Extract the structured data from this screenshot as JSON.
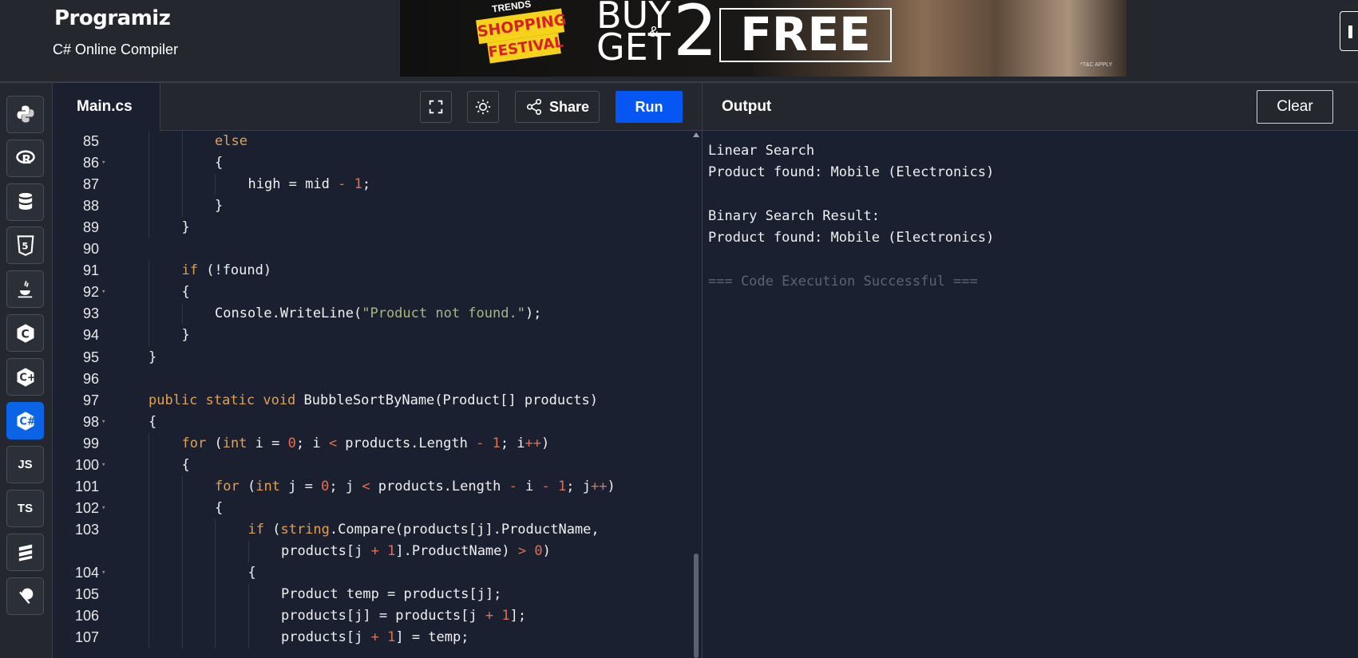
{
  "header": {
    "logo": "Programiz",
    "subtitle": "C# Online Compiler",
    "banner": {
      "trends": "TRENDS",
      "shopping": "SHOPPING",
      "festival": "FESTIVAL",
      "buy": "BUY",
      "amp": "&",
      "get": "GET",
      "two": "2",
      "free": "FREE",
      "tc": "*T&C APPLY"
    }
  },
  "sidebar": {
    "languages": [
      {
        "name": "Python",
        "icon": "python-icon"
      },
      {
        "name": "R",
        "icon": "r-icon"
      },
      {
        "name": "SQL",
        "icon": "database-icon"
      },
      {
        "name": "HTML",
        "icon": "html5-icon"
      },
      {
        "name": "Java",
        "icon": "java-icon"
      },
      {
        "name": "C",
        "icon": "c-icon"
      },
      {
        "name": "C++",
        "icon": "cpp-icon"
      },
      {
        "name": "C#",
        "icon": "csharp-icon",
        "active": true
      },
      {
        "name": "JS",
        "label": "JS",
        "icon": "javascript-icon"
      },
      {
        "name": "TS",
        "label": "TS",
        "icon": "typescript-icon"
      },
      {
        "name": "Swift",
        "icon": "swift-icon"
      },
      {
        "name": "Go",
        "icon": "go-icon"
      }
    ]
  },
  "editor": {
    "file_tab": "Main.cs",
    "share_label": "Share",
    "run_label": "Run"
  },
  "output": {
    "title": "Output",
    "clear_label": "Clear",
    "lines": [
      "Linear Search",
      "Product found: Mobile (Electronics)",
      "",
      "Binary Search Result:",
      "Product found: Mobile (Electronics)",
      "",
      "=== Code Execution Successful ==="
    ]
  },
  "code_lines": [
    {
      "num": "85",
      "fold": false,
      "text": "else"
    },
    {
      "num": "86",
      "fold": true,
      "text": "{"
    },
    {
      "num": "87",
      "fold": false,
      "text": "high = mid - 1;"
    },
    {
      "num": "88",
      "fold": false,
      "text": "}"
    },
    {
      "num": "89",
      "fold": false,
      "text": "}"
    },
    {
      "num": "90",
      "fold": false,
      "text": ""
    },
    {
      "num": "91",
      "fold": false,
      "text": "if (!found)"
    },
    {
      "num": "92",
      "fold": true,
      "text": "{"
    },
    {
      "num": "93",
      "fold": false,
      "text": "Console.WriteLine(\"Product not found.\");"
    },
    {
      "num": "94",
      "fold": false,
      "text": "}"
    },
    {
      "num": "95",
      "fold": false,
      "text": "}"
    },
    {
      "num": "96",
      "fold": false,
      "text": ""
    },
    {
      "num": "97",
      "fold": false,
      "text": "public static void BubbleSortByName(Product[] products)"
    },
    {
      "num": "98",
      "fold": true,
      "text": "{"
    },
    {
      "num": "99",
      "fold": false,
      "text": "for (int i = 0; i < products.Length - 1; i++)"
    },
    {
      "num": "100",
      "fold": true,
      "text": "{"
    },
    {
      "num": "101",
      "fold": false,
      "text": "for (int j = 0; j < products.Length - i - 1; j++)"
    },
    {
      "num": "102",
      "fold": true,
      "text": "{"
    },
    {
      "num": "103",
      "fold": false,
      "text": "if (string.Compare(products[j].ProductName,"
    },
    {
      "num": "",
      "fold": false,
      "text": "products[j + 1].ProductName) > 0)"
    },
    {
      "num": "104",
      "fold": true,
      "text": "{"
    },
    {
      "num": "105",
      "fold": false,
      "text": "Product temp = products[j];"
    },
    {
      "num": "106",
      "fold": false,
      "text": "products[j] = products[j + 1];"
    },
    {
      "num": "107",
      "fold": false,
      "text": "products[j + 1] = temp;"
    }
  ],
  "colors": {
    "run_button": "#0556f3",
    "active_language": "#0b63e5",
    "keyword": "#dfa153",
    "string": "#a9b77a",
    "number": "#e2704f",
    "background": "#1b2030"
  }
}
